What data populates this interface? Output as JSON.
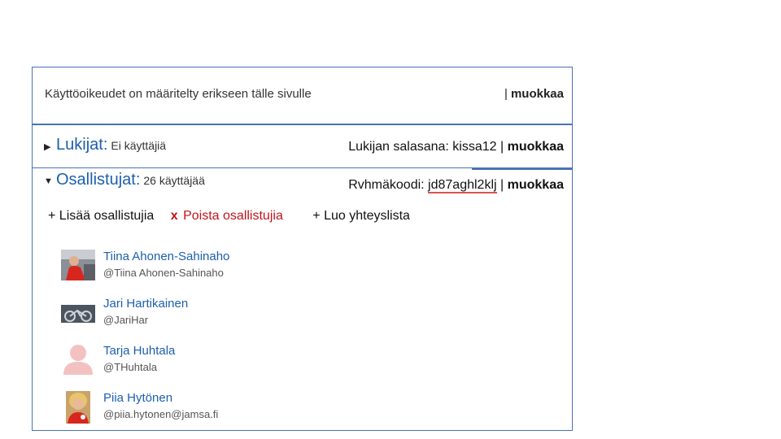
{
  "access": {
    "text": "Käyttöoikeudet on määritelty erikseen tälle sivulle",
    "separator": "|",
    "edit_label": "muokkaa"
  },
  "readers": {
    "toggle_icon": "triangle-right",
    "title": "Lukijat:",
    "count": "Ei käyttäjiä",
    "password_text": "Lukijan salasana: kissa12",
    "separator": "|",
    "edit_label": "muokkaa"
  },
  "participants": {
    "toggle_icon": "triangle-down",
    "title": "Osallistujat:",
    "count": "26 käyttäjää",
    "code_label": "Rvhmäkoodi:",
    "code_value": "jd87aghl2klj",
    "separator": "|",
    "edit_label": "muokkaa",
    "actions": {
      "add": "+ Lisää osallistujia",
      "remove_x": "x",
      "remove": "Poista osallistujia",
      "contact_list": "+ Luo yhteyslista"
    },
    "users": [
      {
        "name": "Tiina Ahonen-Sahinaho",
        "handle": "@Tiina Ahonen-Sahinaho"
      },
      {
        "name": "Jari Hartikainen",
        "handle": "@JariHar"
      },
      {
        "name": "Tarja Huhtala",
        "handle": "@THuhtala"
      },
      {
        "name": "Piia Hytönen",
        "handle": "@piia.hytonen@jamsa.fi"
      }
    ]
  },
  "colors": {
    "border": "#4a72b8",
    "link": "#1d5fae",
    "remove": "#c0141c"
  }
}
